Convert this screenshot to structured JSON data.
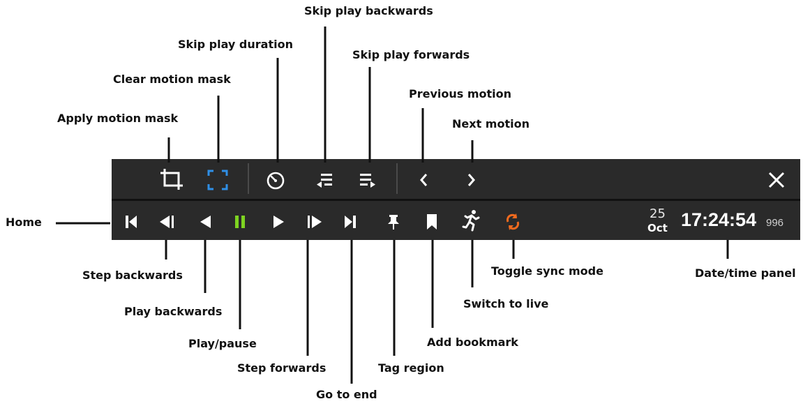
{
  "labels": {
    "skip_play_backwards": "Skip play backwards",
    "skip_play_duration": "Skip play duration",
    "skip_play_forwards": "Skip play forwards",
    "clear_motion_mask": "Clear motion mask",
    "previous_motion": "Previous motion",
    "apply_motion_mask": "Apply motion mask",
    "next_motion": "Next motion",
    "home": "Home",
    "step_backwards": "Step backwards",
    "play_backwards": "Play backwards",
    "play_pause": "Play/pause",
    "step_forwards": "Step forwards",
    "go_to_end": "Go to end",
    "tag_region": "Tag region",
    "add_bookmark": "Add bookmark",
    "switch_to_live": "Switch to live",
    "toggle_sync_mode": "Toggle sync mode",
    "date_time_panel": "Date/time panel"
  },
  "datetime": {
    "day": "25",
    "month": "Oct",
    "time": "17:24:54",
    "milliseconds": "996"
  },
  "icons": {
    "top_row": [
      "crop-icon",
      "clear-mask-icon",
      "timer-icon",
      "skip-back-list-icon",
      "skip-forward-list-icon",
      "chevron-left-icon",
      "chevron-right-icon",
      "close-icon"
    ],
    "bottom_row": [
      "home-icon",
      "step-back-icon",
      "play-backwards-icon",
      "pause-icon",
      "play-icon",
      "step-forward-icon",
      "go-to-end-icon",
      "pin-icon",
      "bookmark-icon",
      "running-person-icon",
      "sync-icon"
    ]
  },
  "colors": {
    "toolbar_bg": "#2a2a2a",
    "icon_default": "#ffffff",
    "clear_mask_accent": "#2f8fe6",
    "pause_accent": "#7ed321",
    "sync_accent": "#f06a1e"
  }
}
